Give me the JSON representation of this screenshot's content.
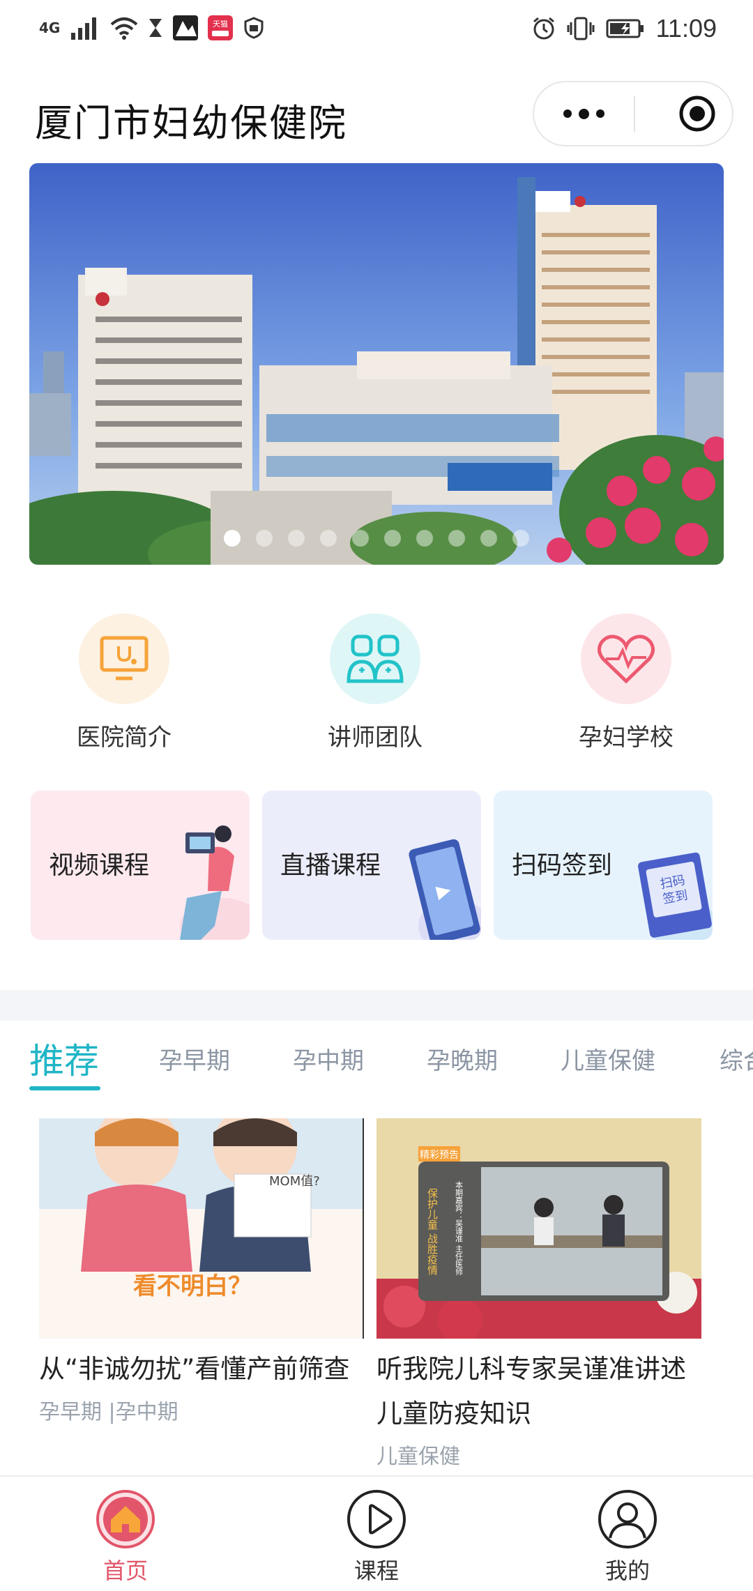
{
  "status_bar": {
    "network": "4G",
    "time": "11:09",
    "app_badge": "天猫"
  },
  "header": {
    "title": "厦门市妇幼保健院"
  },
  "banner": {
    "slide_count": 10,
    "active_index": 0
  },
  "quick_links": [
    {
      "label": "医院简介",
      "icon": "monitor-stethoscope-icon",
      "color": "#f6a33a",
      "bg": "#fdf1e2"
    },
    {
      "label": "讲师团队",
      "icon": "doctors-icon",
      "color": "#22c3c8",
      "bg": "#dff6f7"
    },
    {
      "label": "孕妇学校",
      "icon": "heart-pulse-icon",
      "color": "#ec5a70",
      "bg": "#fde6ea"
    }
  ],
  "course_cards": [
    {
      "label": "视频课程",
      "bg": "#fde9ee"
    },
    {
      "label": "直播课程",
      "bg": "#ecedfb"
    },
    {
      "label": "扫码签到",
      "bg": "#e6f3fd",
      "sign_text": "扫码签到"
    }
  ],
  "tabs": [
    "推荐",
    "孕早期",
    "孕中期",
    "孕晚期",
    "儿童保健",
    "综合"
  ],
  "articles": [
    {
      "title": "从“非诚勿扰”看懂产前筛查",
      "tag": "孕早期 |孕中期",
      "thumb_caption": "看不明白？",
      "thumb_bubble": "MOM值?"
    },
    {
      "title": "听我院儿科专家吴谨准讲述儿童防疫知识",
      "tag": "儿童保健",
      "thumb_badge": "精彩预告",
      "thumb_side": "保护儿童 战胜疫情",
      "thumb_credit": "本期嘉宾：吴谨准 主任医师 厦门市妇幼保健院副院长"
    }
  ],
  "bottom_nav": [
    {
      "label": "首页",
      "icon": "home-icon",
      "active": true
    },
    {
      "label": "课程",
      "icon": "play-circle-icon",
      "active": false
    },
    {
      "label": "我的",
      "icon": "user-icon",
      "active": false
    }
  ],
  "colors": {
    "accent": "#1fb5c6",
    "nav_active": "#e2556a"
  }
}
